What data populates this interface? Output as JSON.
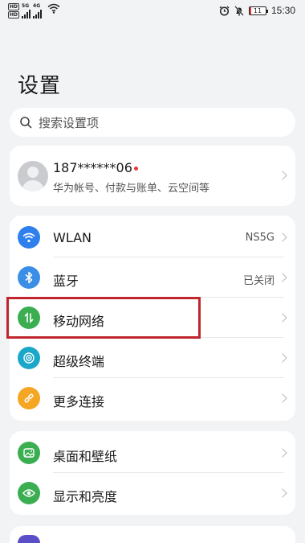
{
  "status_bar": {
    "sim1_label": "HD",
    "sim2_label": "HD",
    "net1": "5G",
    "net2": "4G",
    "battery": "11",
    "time": "15:30"
  },
  "page": {
    "title": "设置"
  },
  "search": {
    "placeholder": "搜索设置项"
  },
  "account": {
    "name": "187******06",
    "subtitle": "华为帐号、付款与账单、云空间等"
  },
  "group1": [
    {
      "label": "WLAN",
      "value": "NS5G",
      "icon": "wifi-icon",
      "color": "#2f80ed"
    },
    {
      "label": "蓝牙",
      "value": "已关闭",
      "icon": "bluetooth-icon",
      "color": "#3a8ee6"
    },
    {
      "label": "移动网络",
      "value": "",
      "icon": "mobile-data-icon",
      "color": "#3cae52"
    },
    {
      "label": "超级终端",
      "value": "",
      "icon": "super-device-icon",
      "color": "#1aa7c9"
    },
    {
      "label": "更多连接",
      "value": "",
      "icon": "link-icon",
      "color": "#f5a623"
    }
  ],
  "group2": [
    {
      "label": "桌面和壁纸",
      "icon": "wallpaper-icon",
      "color": "#3cae52"
    },
    {
      "label": "显示和亮度",
      "icon": "eye-icon",
      "color": "#3cae52"
    }
  ],
  "group3_icon_color": "#5b4fc9"
}
